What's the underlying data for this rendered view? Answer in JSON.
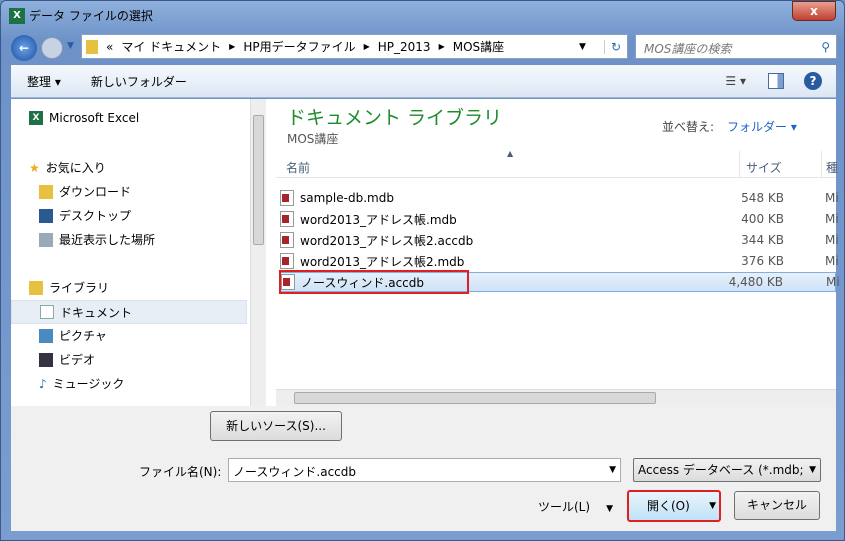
{
  "window": {
    "title": "データ ファイルの選択",
    "close": "x"
  },
  "address": {
    "chevron": "«",
    "crumbs": [
      "マイ ドキュメント",
      "HP用データファイル",
      "HP_2013",
      "MOS講座"
    ],
    "search_placeholder": "MOS講座の検索"
  },
  "toolbar": {
    "organize": "整理 ▾",
    "new_folder": "新しいフォルダー"
  },
  "sidebar": {
    "excel": "Microsoft Excel",
    "favorites": "お気に入り",
    "fav_items": [
      "ダウンロード",
      "デスクトップ",
      "最近表示した場所"
    ],
    "libraries": "ライブラリ",
    "lib_items": [
      "ドキュメント",
      "ピクチャ",
      "ビデオ",
      "ミュージック"
    ]
  },
  "pane": {
    "title": "ドキュメント ライブラリ",
    "subtitle": "MOS講座",
    "sort_label": "並べ替え:",
    "sort_value": "フォルダー ▾",
    "columns": [
      "名前",
      "サイズ",
      "種"
    ],
    "files": [
      {
        "name": "sample-db.mdb",
        "size": "548 KB",
        "type": "Mi"
      },
      {
        "name": "word2013_アドレス帳.mdb",
        "size": "400 KB",
        "type": "Mi"
      },
      {
        "name": "word2013_アドレス帳2.accdb",
        "size": "344 KB",
        "type": "Mi"
      },
      {
        "name": "word2013_アドレス帳2.mdb",
        "size": "376 KB",
        "type": "Mi"
      },
      {
        "name": "ノースウィンド.accdb",
        "size": "4,480 KB",
        "type": "Mi"
      }
    ]
  },
  "bottom": {
    "new_source": "新しいソース(S)...",
    "filename_label": "ファイル名(N):",
    "filename_value": "ノースウィンド.accdb",
    "filter": "Access データベース (*.mdb;",
    "tools": "ツール(L)",
    "open": "開く(O)",
    "cancel": "キャンセル"
  }
}
